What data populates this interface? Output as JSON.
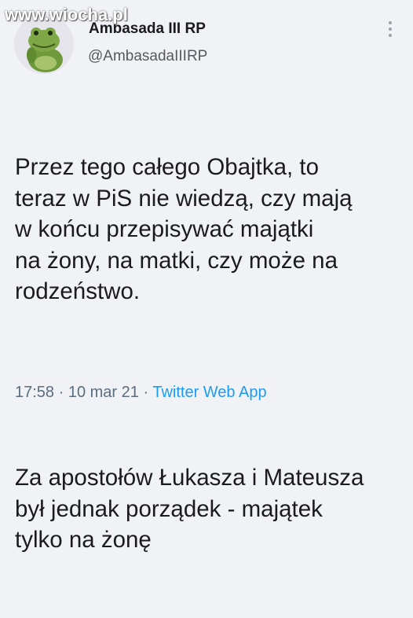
{
  "watermark": "www.wiocha.pl",
  "author": {
    "display_name": "Ambasada III RP",
    "handle": "@AmbasadaIIIRP"
  },
  "tweet": {
    "paragraph_1": "Przez tego całego Obajtka, to\nteraz w PiS nie wiedzą, czy mają\nw końcu przepisywać majątki\nna żony, na matki, czy może na\nrodzeństwo.",
    "paragraph_2": "Za apostołów Łukasza i Mateusza\nbył jednak porządek - majątek\ntylko na żonę"
  },
  "meta": {
    "time": "17:58",
    "separator": " · ",
    "date": "10 mar 21",
    "source": "Twitter Web App"
  },
  "icons": {
    "avatar": "frog-avatar",
    "more": "more-vertical-icon"
  },
  "colors": {
    "background": "#f1f2f6",
    "link": "#1d9bf0",
    "meta": "#5b6d7e"
  }
}
